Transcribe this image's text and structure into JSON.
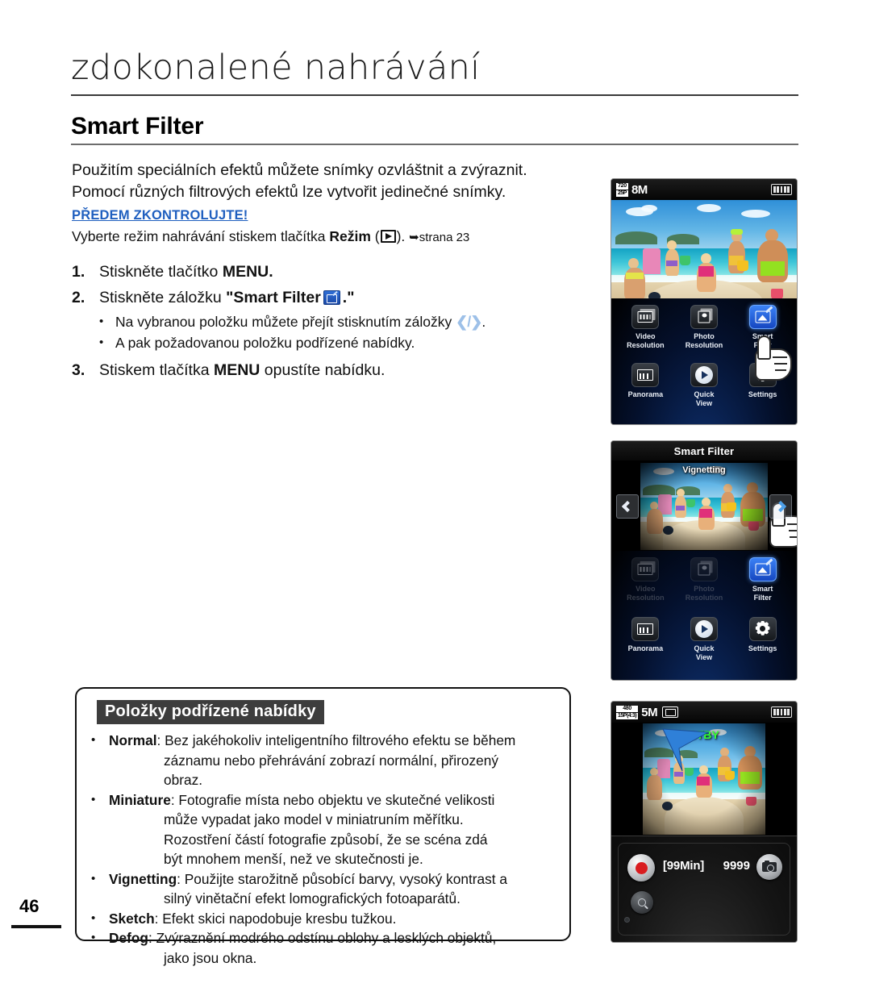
{
  "header": {
    "chapter_title": "zdokonalené nahrávání",
    "section_title": "Smart Filter"
  },
  "intro": {
    "line1": "Použitím speciálních efektů můžete snímky ozvláštnit a zvýraznit.",
    "line2": "Pomocí různých filtrových efektů lze vytvořit jedinečné snímky."
  },
  "precheck": {
    "heading": "PŘEDEM ZKONTROLUJTE!",
    "text_before": "Vyberte režim nahrávání stiskem tlačítka ",
    "bold_word": "Režim",
    "icon": "mode-play-icon",
    "text_after": ". ",
    "page_ref": "strana 23"
  },
  "steps": [
    {
      "num": "1.",
      "text_before": "Stiskněte tlačítko ",
      "bold": "MENU.",
      "text_after": ""
    },
    {
      "num": "2.",
      "text_before": "Stiskněte záložku ",
      "bold": "\"Smart Filter",
      "icon": "smart-filter-icon",
      "text_after": ".\""
    },
    {
      "num": "3.",
      "text_before": "Stiskem tlačítka ",
      "bold": "MENU",
      "text_after": " opustíte nabídku."
    }
  ],
  "substeps": [
    {
      "text_before": "Na vybranou položku můžete přejít stisknutím záložky ",
      "icon": "chevron-left-right-icon",
      "text_after": "."
    },
    {
      "text_before": "A pak požadovanou položku podřízené nabídky.",
      "text_after": ""
    }
  ],
  "submenu_box": {
    "heading": "Položky podřízené nabídky",
    "items": [
      {
        "name": "Normal",
        "lines": [
          ": Bez jakéhokoliv inteligentního filtrového efektu se během",
          "záznamu nebo přehrávání zobrazí normální, přirozený",
          "obraz."
        ]
      },
      {
        "name": "Miniature",
        "lines": [
          ": Fotografie místa nebo objektu ve skutečné velikosti",
          "může vypadat jako model v miniatruním měřítku.",
          "Rozostření částí fotografie způsobí, že se scéna zdá",
          "být mnohem menší, než ve skutečnosti je."
        ]
      },
      {
        "name": "Vignetting",
        "lines": [
          ": Použijte starožitně působící barvy, vysoký kontrast a",
          "silný vinětační efekt lomografických fotoaparátů."
        ]
      },
      {
        "name": "Sketch",
        "lines": [
          ": Efekt skici napodobuje kresbu tužkou."
        ]
      },
      {
        "name": "Defog",
        "lines": [
          ": Zvýraznění modrého odstínu oblohy a lesklých objektů,",
          "jako jsou okna."
        ]
      }
    ]
  },
  "page_number": "46",
  "screens": [
    {
      "id": "screen-menu",
      "status": {
        "res_top": "720",
        "res_bottom": "25P",
        "megapixels": "8M"
      },
      "menu": [
        {
          "label_line1": "Video",
          "label_line2": "Resolution",
          "icon": "video-resolution-icon",
          "state": "normal"
        },
        {
          "label_line1": "Photo",
          "label_line2": "Resolution",
          "icon": "photo-resolution-icon",
          "state": "normal"
        },
        {
          "label_line1": "Smart",
          "label_line2": "Filter",
          "icon": "smart-filter-icon",
          "state": "selected"
        },
        {
          "label_line1": "Panorama",
          "label_line2": "",
          "icon": "panorama-icon",
          "state": "normal"
        },
        {
          "label_line1": "Quick",
          "label_line2": "View",
          "icon": "quick-view-icon",
          "state": "normal"
        },
        {
          "label_line1": "Settings",
          "label_line2": "",
          "icon": "settings-gear-icon",
          "state": "normal"
        }
      ]
    },
    {
      "id": "screen-smart-filter",
      "title": "Smart Filter",
      "preview_label": "Vignetting",
      "nav_left": "chevron-left-icon",
      "nav_right": "chevron-right-icon",
      "menu": [
        {
          "label_line1": "Video",
          "label_line2": "Resolution",
          "icon": "video-resolution-icon",
          "state": "disabled"
        },
        {
          "label_line1": "Photo",
          "label_line2": "Resolution",
          "icon": "photo-resolution-icon",
          "state": "disabled"
        },
        {
          "label_line1": "Smart",
          "label_line2": "Filter",
          "icon": "smart-filter-icon",
          "state": "selected"
        },
        {
          "label_line1": "Panorama",
          "label_line2": "",
          "icon": "panorama-icon",
          "state": "normal"
        },
        {
          "label_line1": "Quick",
          "label_line2": "View",
          "icon": "quick-view-icon",
          "state": "normal"
        },
        {
          "label_line1": "Settings",
          "label_line2": "",
          "icon": "settings-gear-icon",
          "state": "normal"
        }
      ]
    },
    {
      "id": "screen-standby",
      "status": {
        "res_top": "480",
        "res_bottom": "15P(4:3)",
        "megapixels": "5M",
        "filter_badge": "smart-filter-badge-icon"
      },
      "standby_text": "STBY",
      "controls": {
        "record_time": "[99Min]",
        "shot_count": "9999",
        "record_button": "record-button",
        "zoom_button": "zoom-button",
        "photo_button": "photo-capture-button"
      }
    }
  ],
  "colors": {
    "precheck_blue": "#1f5fbf",
    "selected_blue": "#2f6fd6",
    "standby_green": "#34ff34",
    "record_red": "#d91d20",
    "arrow_blue": "#2f80d8"
  }
}
